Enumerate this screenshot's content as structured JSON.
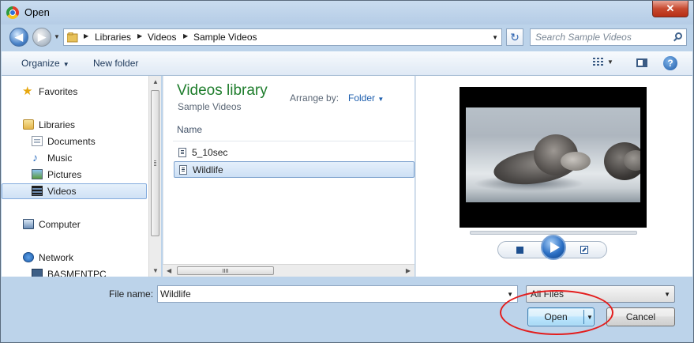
{
  "window": {
    "title": "Open",
    "close_glyph": "✕"
  },
  "address_bar": {
    "breadcrumbs": [
      "Libraries",
      "Videos",
      "Sample Videos"
    ],
    "separator_glyph": "▶",
    "search_placeholder": "Search Sample Videos"
  },
  "toolbar": {
    "organize_label": "Organize",
    "new_folder_label": "New folder",
    "help_glyph": "?"
  },
  "nav": {
    "favorites": "Favorites",
    "libraries": "Libraries",
    "library_items": [
      "Documents",
      "Music",
      "Pictures",
      "Videos"
    ],
    "selected": "Videos",
    "computer": "Computer",
    "network": "Network",
    "network_item": "BASMENTPC"
  },
  "file_list": {
    "library_title": "Videos library",
    "library_subtitle": "Sample Videos",
    "arrange_by_label": "Arrange by:",
    "arrange_by_value": "Folder",
    "column_name": "Name",
    "files": [
      "5_10sec",
      "Wildlife"
    ],
    "selected_file": "Wildlife"
  },
  "footer": {
    "file_name_label": "File name:",
    "file_name_value": "Wildlife",
    "file_type_filter": "All Files",
    "open_label": "Open",
    "cancel_label": "Cancel"
  },
  "colors": {
    "library_title": "#1e7d2c",
    "selection": "#cde0f5",
    "annotation": "#e31d1d"
  },
  "icons": [
    "chrome-icon",
    "back-icon",
    "forward-icon",
    "folder-icon",
    "refresh-icon",
    "search-icon",
    "star-icon",
    "library-icon",
    "document-icon",
    "music-icon",
    "pictures-icon",
    "videos-icon",
    "computer-icon",
    "network-icon",
    "video-file-icon",
    "stop-icon",
    "play-icon",
    "popout-icon",
    "help-icon"
  ]
}
